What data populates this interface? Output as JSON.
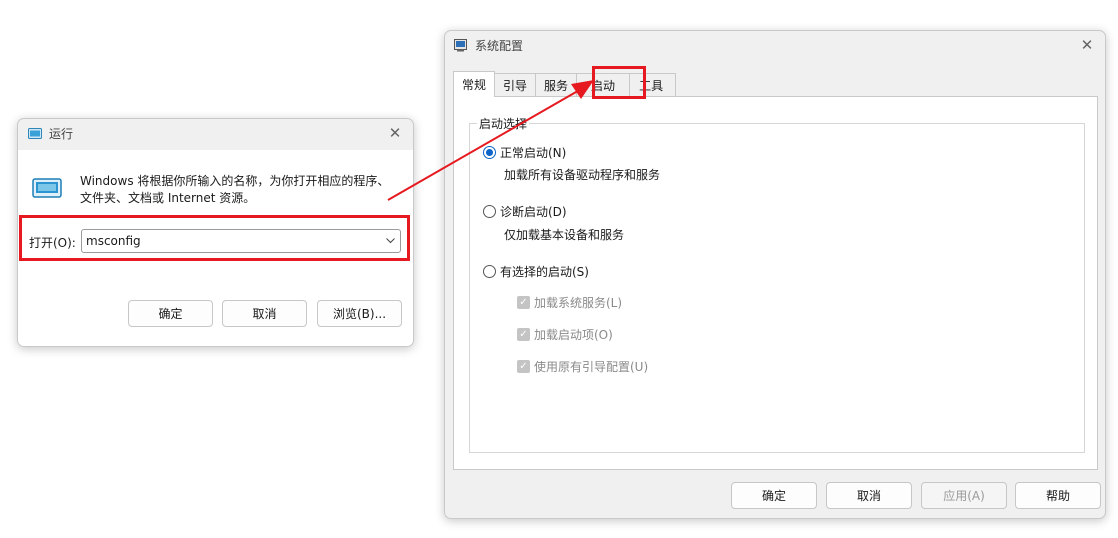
{
  "run_dialog": {
    "title": "运行",
    "description": "Windows 将根据你所输入的名称，为你打开相应的程序、文件夹、文档或 Internet 资源。",
    "open_label": "打开(O):",
    "open_value": "msconfig",
    "buttons": {
      "ok": "确定",
      "cancel": "取消",
      "browse": "浏览(B)..."
    }
  },
  "msconfig": {
    "title": "系统配置",
    "tabs": [
      "常规",
      "引导",
      "服务",
      "启动",
      "工具"
    ],
    "group_title": "启动选择",
    "options": [
      {
        "label": "正常启动(N)",
        "desc": "加载所有设备驱动程序和服务",
        "selected": true
      },
      {
        "label": "诊断启动(D)",
        "desc": "仅加载基本设备和服务",
        "selected": false
      },
      {
        "label": "有选择的启动(S)",
        "selected": false
      }
    ],
    "checks": [
      "加载系统服务(L)",
      "加载启动项(O)",
      "使用原有引导配置(U)"
    ],
    "buttons": {
      "ok": "确定",
      "cancel": "取消",
      "apply": "应用(A)",
      "help": "帮助"
    }
  },
  "colors": {
    "highlight": "#e5191f",
    "accent": "#0a64c8"
  }
}
